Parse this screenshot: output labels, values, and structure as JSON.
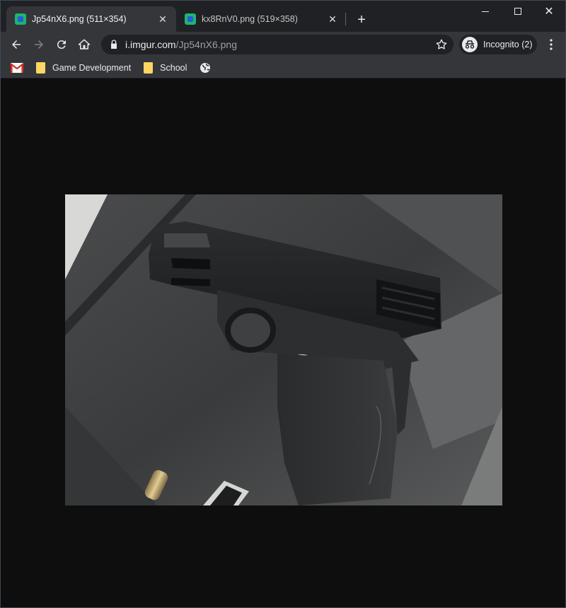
{
  "browser": {
    "tabs": [
      {
        "title": "Jp54nX6.png (511×354)",
        "active": true
      },
      {
        "title": "kx8RnV0.png (519×358)",
        "active": false
      }
    ],
    "new_tab_label": "+",
    "address": {
      "host": "i.imgur.com",
      "path": "/Jp54nX6.png"
    },
    "profile_label": "Incognito (2)",
    "bookmarks": [
      {
        "label": "",
        "icon": "gmail-icon"
      },
      {
        "label": "Game Development",
        "icon": "folder-icon"
      },
      {
        "label": "School",
        "icon": "folder-icon"
      },
      {
        "label": "",
        "icon": "globe-icon"
      }
    ]
  },
  "viewer": {
    "image_subject": "handgun photo",
    "background": "#0e0e0e"
  },
  "colors": {
    "tabstrip": "#202124",
    "toolbar": "#35363a",
    "folder": "#fdd663",
    "favicon": "#1bb76e"
  }
}
